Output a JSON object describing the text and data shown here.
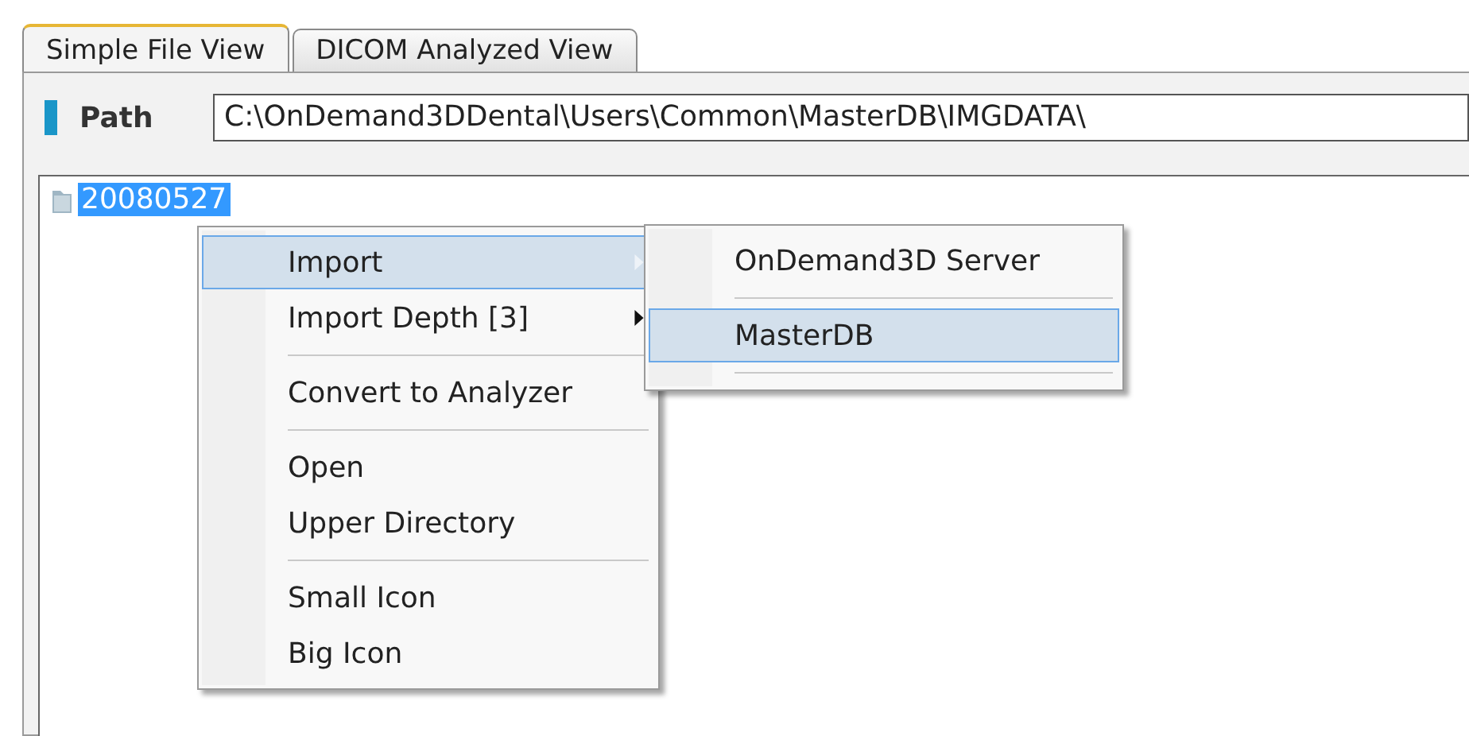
{
  "tabs": [
    {
      "label": "Simple File View",
      "selected": true
    },
    {
      "label": "DICOM Analyzed View",
      "selected": false
    }
  ],
  "path": {
    "label": "Path",
    "value": "C:\\OnDemand3DDental\\Users\\Common\\MasterDB\\IMGDATA\\"
  },
  "tree": {
    "items": [
      {
        "label": "20080527",
        "selected": true
      }
    ]
  },
  "context_menu": {
    "items": [
      {
        "kind": "item",
        "label": "Import",
        "submenu": true,
        "selected": true
      },
      {
        "kind": "item",
        "label": "Import Depth [3]",
        "submenu": true,
        "selected": false
      },
      {
        "kind": "separator"
      },
      {
        "kind": "item",
        "label": "Convert to Analyzer",
        "submenu": false,
        "selected": false
      },
      {
        "kind": "separator"
      },
      {
        "kind": "item",
        "label": "Open",
        "submenu": false,
        "selected": false
      },
      {
        "kind": "item",
        "label": "Upper Directory",
        "submenu": false,
        "selected": false
      },
      {
        "kind": "separator"
      },
      {
        "kind": "item",
        "label": "Small Icon",
        "submenu": false,
        "selected": false
      },
      {
        "kind": "item",
        "label": "Big Icon",
        "submenu": false,
        "selected": false
      }
    ]
  },
  "submenu": {
    "items": [
      {
        "kind": "item",
        "label": "OnDemand3D Server",
        "selected": false
      },
      {
        "kind": "separator"
      },
      {
        "kind": "item",
        "label": "MasterDB",
        "selected": true
      },
      {
        "kind": "separator"
      }
    ]
  }
}
